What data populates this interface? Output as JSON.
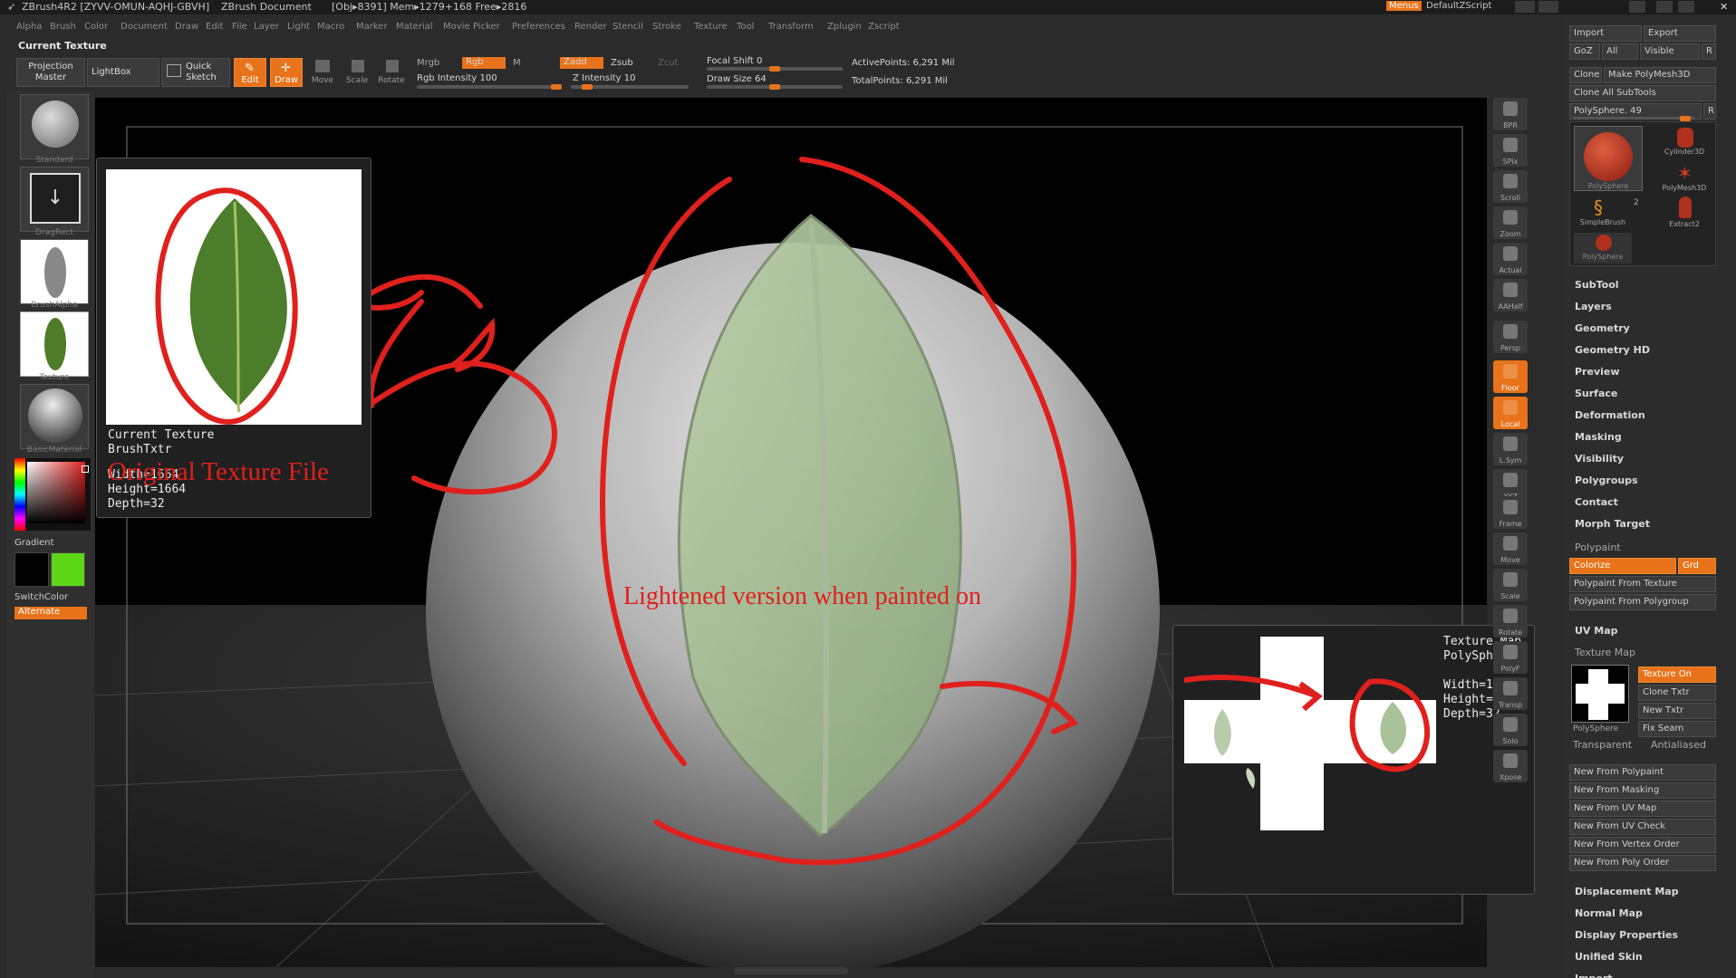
{
  "titlebar": {
    "app": "ZBrush4R2 [ZYVV-OMUN-AQHJ-GBVH]",
    "doc": "ZBrush Document",
    "stats": "[Obj▸8391]  Mem▸1279+168  Free▸2816",
    "menus_btn": "Menus",
    "script": "DefaultZScript"
  },
  "menubar": [
    "Alpha",
    "Brush",
    "Color",
    "Document",
    "Draw",
    "Edit",
    "File",
    "Layer",
    "Light",
    "Macro",
    "Marker",
    "Material",
    "Movie",
    "Picker",
    "Preferences",
    "Render",
    "Stencil",
    "Stroke",
    "Texture",
    "Tool",
    "Transform",
    "Zplugin",
    "Zscript"
  ],
  "toolbar": {
    "current_texture": "Current Texture",
    "projection_master": "Projection Master",
    "lightbox": "LightBox",
    "quick_sketch": "Quick Sketch",
    "edit": "Edit",
    "draw": "Draw",
    "move": "Move",
    "scale": "Scale",
    "rotate": "Rotate",
    "mrgb": "Mrgb",
    "rgb": "Rgb",
    "m": "M",
    "rgb_intensity": "Rgb Intensity 100",
    "zadd": "Zadd",
    "zsub": "Zsub",
    "zcut": "Zcut",
    "z_intensity": "Z Intensity 10",
    "focal_shift": "Focal Shift 0",
    "draw_size": "Draw Size 64",
    "active_points": "ActivePoints: 6,291  Mil",
    "total_points": "TotalPoints: 6,291  Mil",
    "rgb_intensity_value": 100,
    "z_intensity_value": 10,
    "focal_shift_value": 0,
    "draw_size_value": 64
  },
  "leftshelf": {
    "brush": "Standard",
    "stroke": "DragRect",
    "alpha": "BrushAlpha",
    "texture": "Texture",
    "material": "BasicMaterial",
    "gradient": "Gradient",
    "switchcolor": "SwitchColor",
    "alternate": "Alternate"
  },
  "popup_current": {
    "line1": "Current Texture",
    "line2": "BrushTxtr",
    "line3": "Width=1664",
    "line4": "Height=1664",
    "line5": "Depth=32"
  },
  "popup_texmap": {
    "line1": "Texture Map",
    "line2": "PolySphere",
    "line3": "Width=1024",
    "line4": "Height=1024",
    "line5": "Depth=32"
  },
  "annotations": {
    "original": "Original Texture File",
    "lightened": "Lightened version when painted on"
  },
  "viewtools": [
    "BPR",
    "SPix",
    "Scroll",
    "Zoom",
    "Actual",
    "AAHalf",
    "Persp",
    "Floor",
    "Local",
    "L.Sym",
    "XYZ",
    "Frame",
    "Move",
    "Scale",
    "Rotate",
    "PolyF",
    "Transp",
    "Solo",
    "Xpose"
  ],
  "rightpanel": {
    "import": "Import",
    "export": "Export",
    "goz": "GoZ",
    "all": "All",
    "visible": "Visible",
    "r": "R",
    "clone": "Clone",
    "make_polymesh": "Make PolyMesh3D",
    "clone_all": "Clone  All SubTools",
    "polysphere_slider": "PolySphere. 49",
    "tools": [
      "PolySphere",
      "Cylinder3D",
      "PolyMesh3D",
      "SimpleBrush",
      "Extract2",
      "PolySphere"
    ],
    "tool_count": "2",
    "menus": [
      "SubTool",
      "Layers",
      "Geometry",
      "Geometry HD",
      "Preview",
      "Surface",
      "Deformation",
      "Masking",
      "Visibility",
      "Polygroups",
      "Contact",
      "Morph Target"
    ],
    "polypaint": "Polypaint",
    "colorize": "Colorize",
    "grd": "Grd",
    "pp_from_texture": "Polypaint From Texture",
    "pp_from_polygroup": "Polypaint From Polygroup",
    "uv_map": "UV Map",
    "texture_map": "Texture Map",
    "texture_on": "Texture On",
    "clone_txtr": "Clone Txtr",
    "new_txtr": "New Txtr",
    "fix_seam": "Fix Seam",
    "tm_thumb_label": "PolySphere",
    "transparent": "Transparent",
    "antialiased": "Antialiased",
    "new_from": [
      "New From Polypaint",
      "New From Masking",
      "New From UV Map",
      "New From UV Check",
      "New From Vertex Order",
      "New From Poly Order"
    ],
    "menus2": [
      "Displacement Map",
      "Normal Map",
      "Display Properties",
      "Unified Skin",
      "Import"
    ]
  },
  "colors": {
    "accent": "#e8731b",
    "annotation_red": "#e0201c"
  }
}
